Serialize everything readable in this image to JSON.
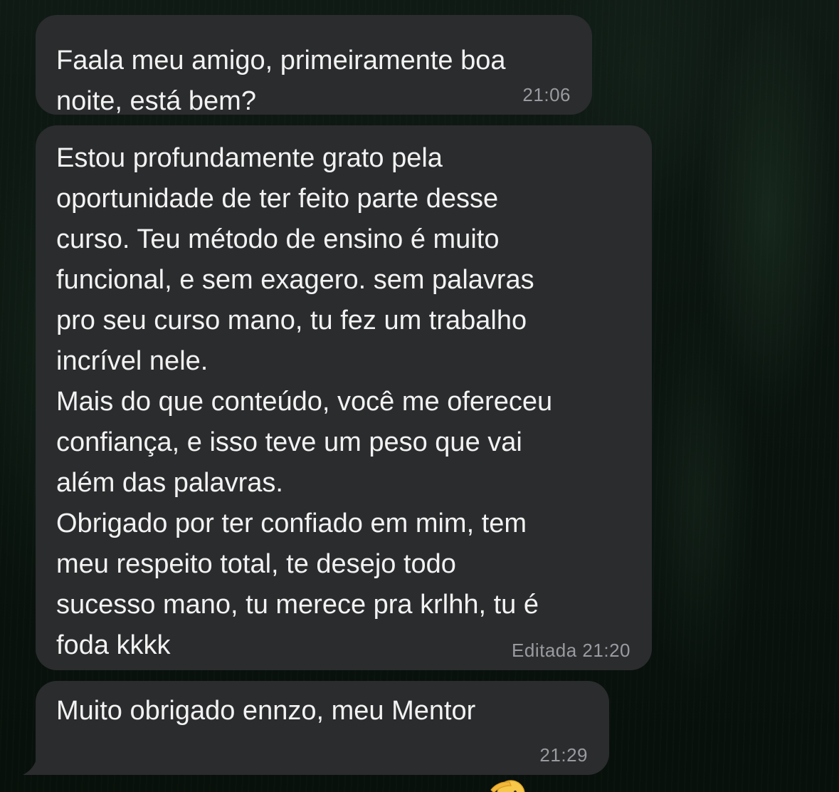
{
  "messages": [
    {
      "text": "Faala meu amigo, primeiramente boa\nnoite, está bem?",
      "time": "21:06"
    },
    {
      "text": "Estou profundamente grato pela\noportunidade de ter feito parte desse\ncurso. Teu método de ensino é muito\nfuncional, e sem exagero. sem palavras\npro seu curso mano, tu fez um trabalho\nincrível nele.\nMais do que conteúdo, você me ofereceu\nconfiança, e isso teve um peso que vai\nalém das palavras.\nObrigado por ter confiado em mim, tem\nmeu respeito total, te desejo todo\nsucesso mano, tu merece pra krlhh, tu é\nfoda kkkk",
      "time": "Editada 21:20"
    },
    {
      "text": "Muito obrigado ennzo, meu Mentor",
      "time": "21:29",
      "emoji": "saluting-face-emoji"
    }
  ],
  "colors": {
    "bubble": "#2b2c2e",
    "text": "#f2f2f2",
    "meta": "#9a9ba0",
    "wallpaper": "#0b1410"
  }
}
